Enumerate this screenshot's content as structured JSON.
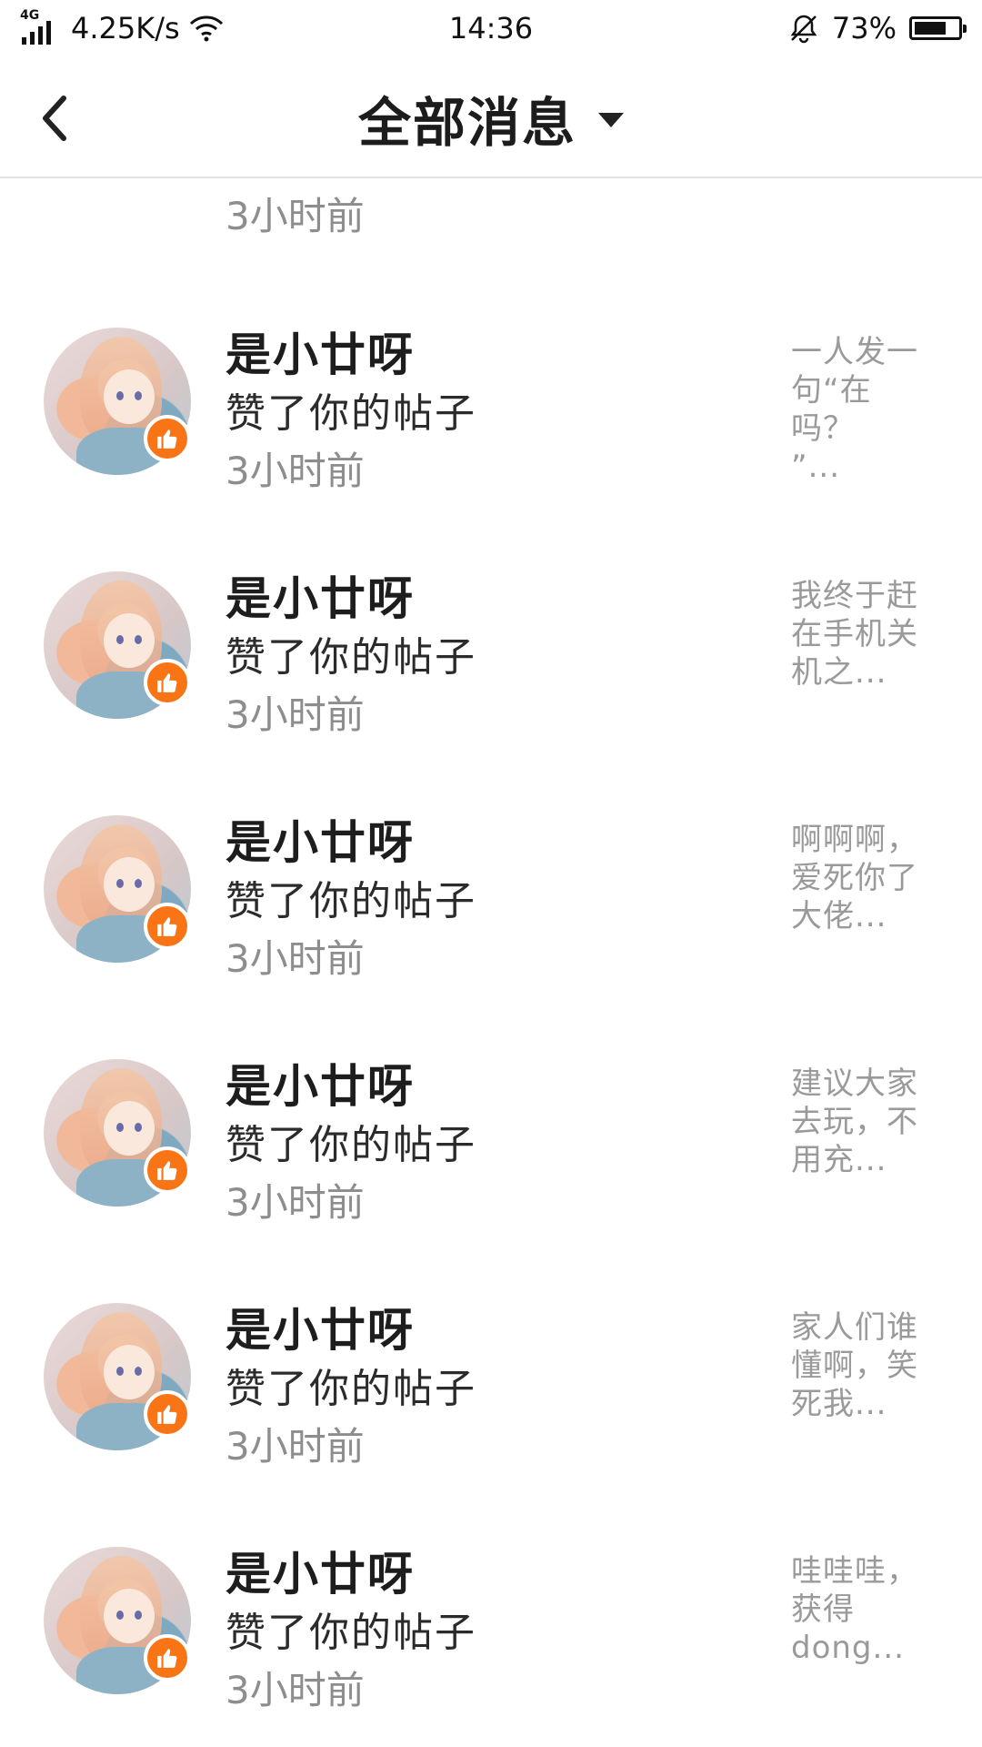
{
  "status_bar": {
    "network": "4G",
    "speed": "4.25K/s",
    "time": "14:36",
    "battery_text": "73%",
    "battery_level": 0.73
  },
  "header": {
    "title": "全部消息"
  },
  "partial_item": {
    "time": "3小时前"
  },
  "items": [
    {
      "name": "是小廿呀",
      "action": "赞了你的帖子",
      "time": "3小时前",
      "preview": [
        "一人发一",
        "句“在吗？",
        "”..."
      ]
    },
    {
      "name": "是小廿呀",
      "action": "赞了你的帖子",
      "time": "3小时前",
      "preview": [
        "我终于赶",
        "在手机关",
        "机之..."
      ]
    },
    {
      "name": "是小廿呀",
      "action": "赞了你的帖子",
      "time": "3小时前",
      "preview": [
        "啊啊啊，",
        "爱死你了",
        "大佬..."
      ]
    },
    {
      "name": "是小廿呀",
      "action": "赞了你的帖子",
      "time": "3小时前",
      "preview": [
        "建议大家",
        "去玩，不",
        "用充..."
      ]
    },
    {
      "name": "是小廿呀",
      "action": "赞了你的帖子",
      "time": "3小时前",
      "preview": [
        "家人们谁",
        "懂啊，笑",
        "死我..."
      ]
    },
    {
      "name": "是小廿呀",
      "action": "赞了你的帖子",
      "time": "3小时前",
      "preview": [
        "哇哇哇，",
        "获得",
        "dong..."
      ]
    }
  ]
}
